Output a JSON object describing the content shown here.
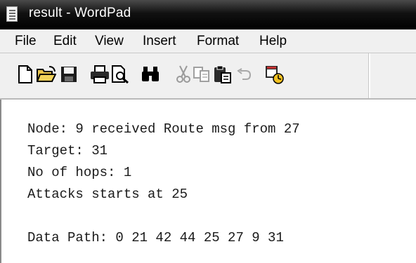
{
  "window": {
    "title": "result - WordPad",
    "icon": "wordpad-document-icon"
  },
  "menu": {
    "file": "File",
    "edit": "Edit",
    "view": "View",
    "insert": "Insert",
    "format": "Format",
    "help": "Help"
  },
  "toolbar": {
    "icons": [
      "new-document-icon",
      "open-folder-icon",
      "save-disk-icon",
      "print-icon",
      "print-preview-icon",
      "find-binoculars-icon",
      "cut-scissors-icon",
      "copy-icon",
      "paste-clipboard-icon",
      "undo-icon",
      "insert-date-time-icon"
    ]
  },
  "document": {
    "lines": [
      "Node: 9 received Route msg from 27",
      "Target: 31",
      "No of hops: 1",
      "Attacks starts at 25",
      "",
      "Data Path: 0 21 42 44 25 27 9 31"
    ]
  },
  "colors": {
    "titlebar": "#000000",
    "title_text": "#ffffff",
    "chrome": "#f0f0f0",
    "document_bg": "#ffffff"
  }
}
